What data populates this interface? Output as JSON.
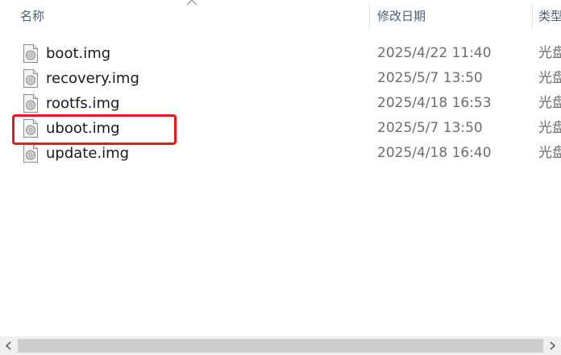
{
  "header": {
    "col_name": "名称",
    "col_date": "修改日期",
    "col_type": "类型"
  },
  "files": [
    {
      "name": "boot.img",
      "date": "2025/4/22 11:40",
      "type": "光盘"
    },
    {
      "name": "recovery.img",
      "date": "2025/5/7 13:50",
      "type": "光盘"
    },
    {
      "name": "rootfs.img",
      "date": "2025/4/18 16:53",
      "type": "光盘"
    },
    {
      "name": "uboot.img",
      "date": "2025/5/7 13:50",
      "type": "光盘"
    },
    {
      "name": "update.img",
      "date": "2025/4/18 16:40",
      "type": "光盘"
    }
  ],
  "icons": {
    "file": "disc-image-file-icon",
    "sort": "sort-ascending-icon",
    "scroll_left": "scroll-left-arrow-icon",
    "scroll_right": "scroll-right-arrow-icon"
  },
  "colors": {
    "highlight": "#e8191b",
    "header_text": "#4c607a",
    "date_text": "#6d6d6d"
  }
}
